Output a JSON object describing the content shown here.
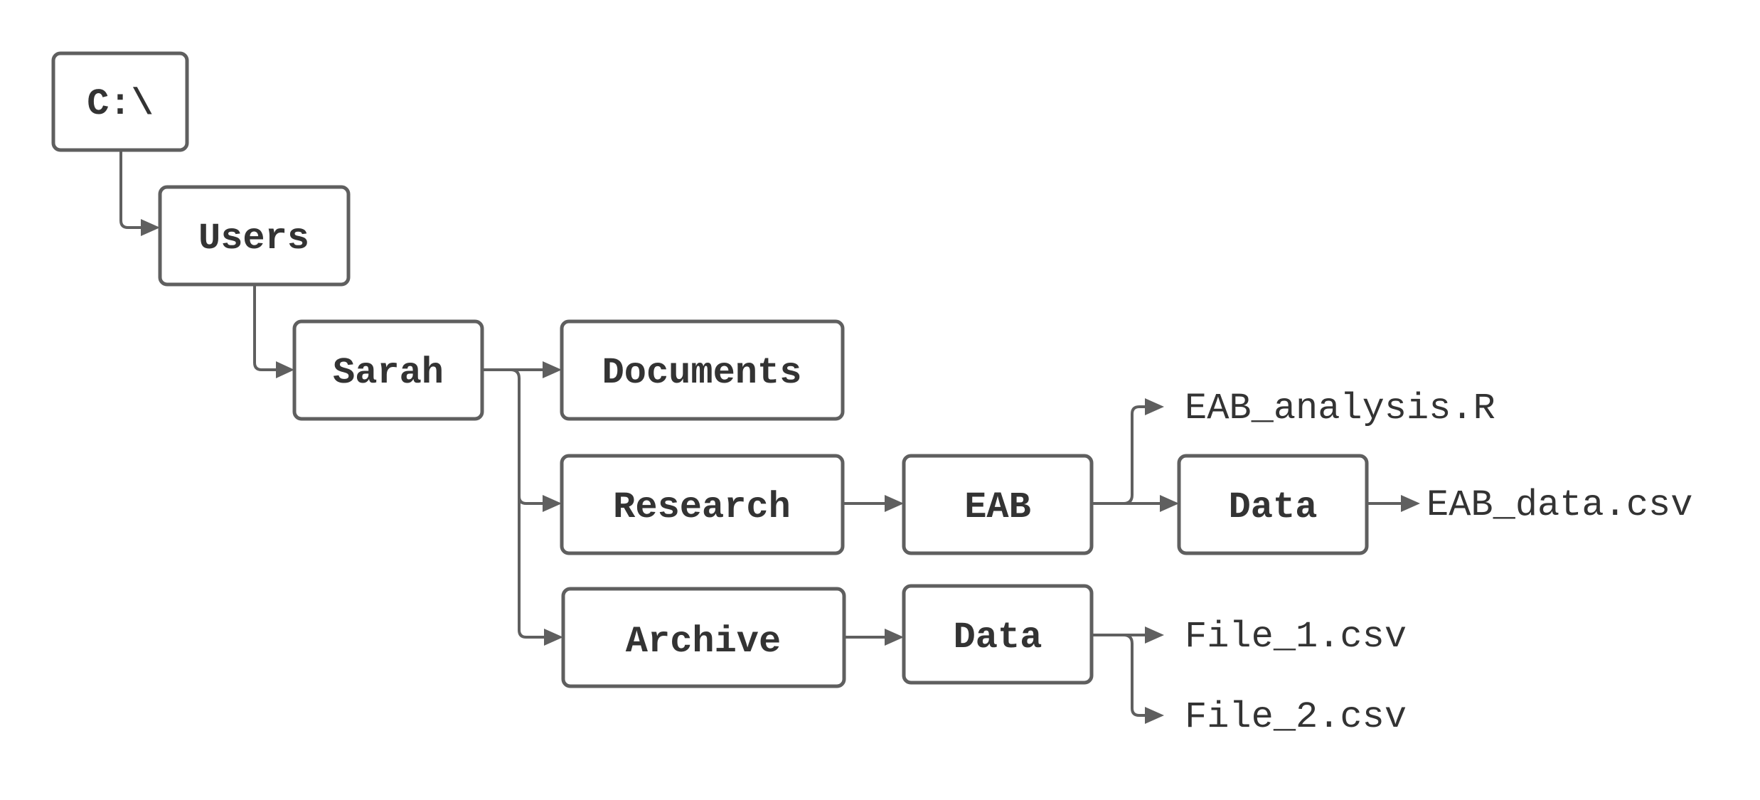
{
  "diagram": {
    "title": "",
    "nodes": [
      {
        "id": "root",
        "label": "C:\\",
        "kind": "folder"
      },
      {
        "id": "users",
        "label": "Users",
        "kind": "folder"
      },
      {
        "id": "sarah",
        "label": "Sarah",
        "kind": "folder"
      },
      {
        "id": "documents",
        "label": "Documents",
        "kind": "folder"
      },
      {
        "id": "research",
        "label": "Research",
        "kind": "folder"
      },
      {
        "id": "archive",
        "label": "Archive",
        "kind": "folder"
      },
      {
        "id": "eab",
        "label": "EAB",
        "kind": "folder"
      },
      {
        "id": "eab_data",
        "label": "Data",
        "kind": "folder"
      },
      {
        "id": "archive_data",
        "label": "Data",
        "kind": "folder"
      },
      {
        "id": "eab_analysis",
        "label": "EAB_analysis.R",
        "kind": "file"
      },
      {
        "id": "eab_data_csv",
        "label": "EAB_data.csv",
        "kind": "file"
      },
      {
        "id": "file1",
        "label": "File_1.csv",
        "kind": "file"
      },
      {
        "id": "file2",
        "label": "File_2.csv",
        "kind": "file"
      }
    ],
    "edges": [
      {
        "from": "root",
        "to": "users"
      },
      {
        "from": "users",
        "to": "sarah"
      },
      {
        "from": "sarah",
        "to": "documents"
      },
      {
        "from": "sarah",
        "to": "research"
      },
      {
        "from": "sarah",
        "to": "archive"
      },
      {
        "from": "research",
        "to": "eab"
      },
      {
        "from": "eab",
        "to": "eab_analysis"
      },
      {
        "from": "eab",
        "to": "eab_data"
      },
      {
        "from": "eab_data",
        "to": "eab_data_csv"
      },
      {
        "from": "archive",
        "to": "archive_data"
      },
      {
        "from": "archive_data",
        "to": "file1"
      },
      {
        "from": "archive_data",
        "to": "file2"
      }
    ],
    "colors": {
      "stroke": "#5f5f5f",
      "text": "#333333",
      "background": "#ffffff"
    }
  }
}
